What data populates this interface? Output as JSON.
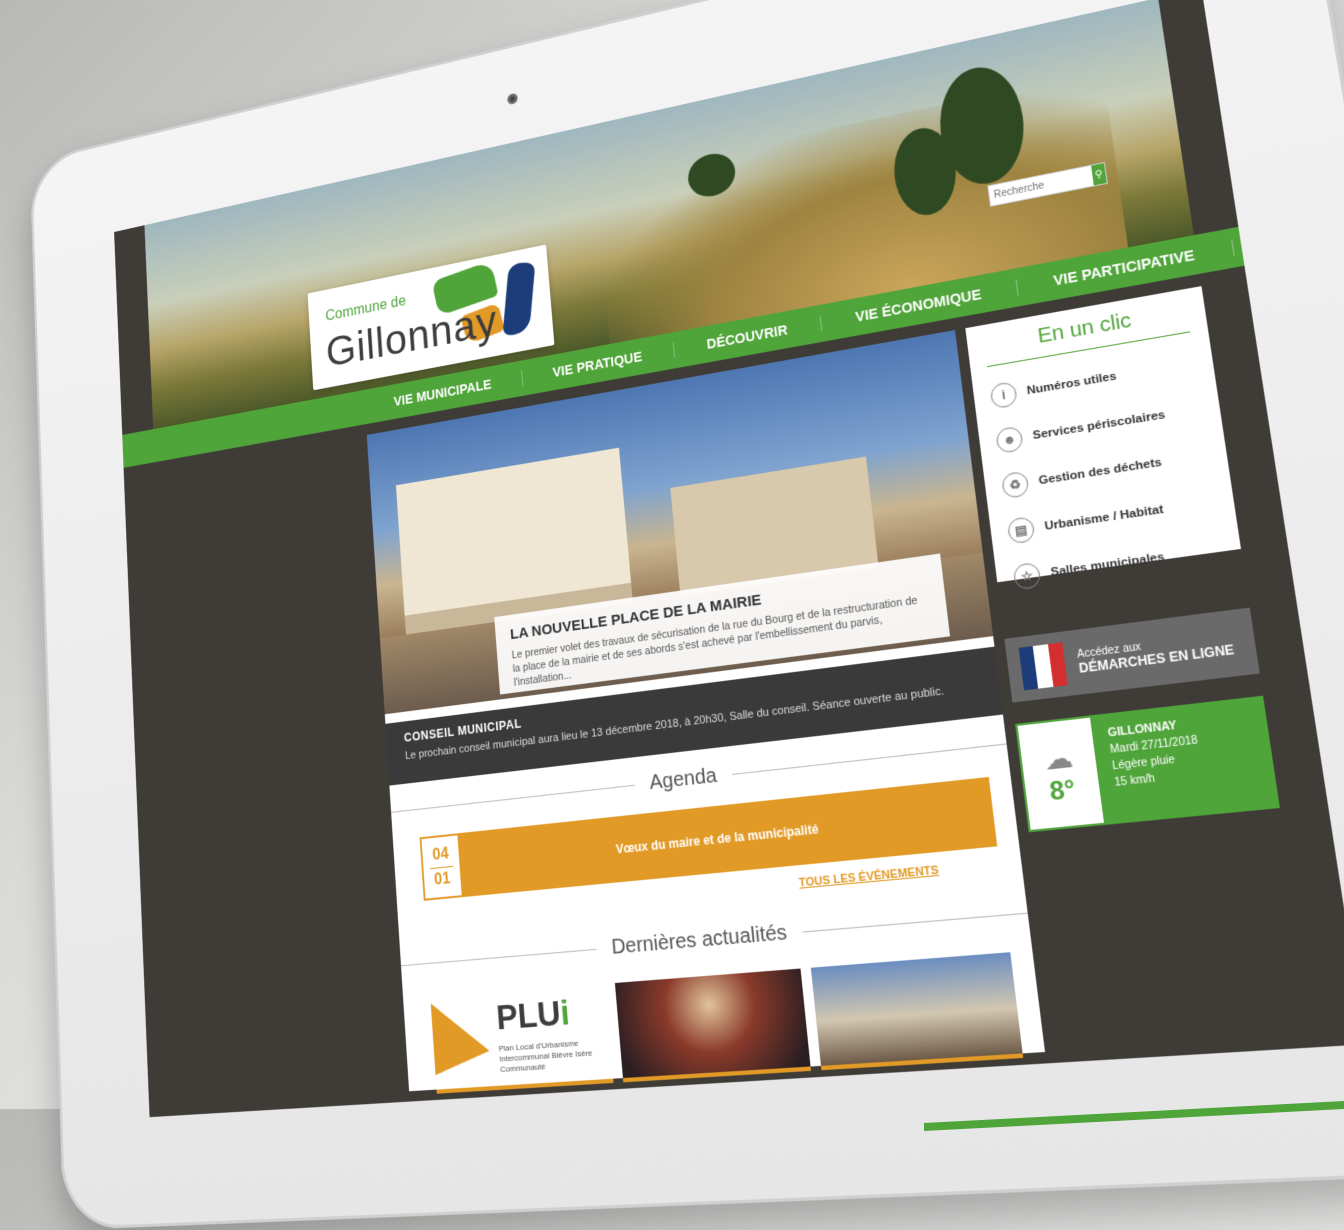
{
  "header": {
    "logo_small": "Commune de",
    "logo_big": "Gillonnay",
    "search_placeholder": "Recherche"
  },
  "nav": [
    "VIE MUNICIPALE",
    "VIE PRATIQUE",
    "DÉCOUVRIR",
    "VIE ÉCONOMIQUE",
    "VIE PARTICIPATIVE"
  ],
  "slide": {
    "title": "LA NOUVELLE PLACE DE LA MAIRIE",
    "desc": "Le premier volet des travaux de sécurisation de la rue du Bourg et de la restructuration de la place de la mairie et de ses abords s'est achevé par l'embellissement du parvis, l'installation..."
  },
  "conseil": {
    "title": "CONSEIL MUNICIPAL",
    "text": "Le prochain conseil municipal aura lieu le 13 décembre 2018, à 20h30, Salle du conseil. Séance ouverte au public."
  },
  "agenda": {
    "title": "Agenda",
    "event": {
      "day": "04",
      "month": "01",
      "label": "Vœux du maire et de la municipalité"
    },
    "all_events": "TOUS LES ÉVÉNEMENTS"
  },
  "news": {
    "title": "Dernières actualités",
    "plui_title": "PLU",
    "plui_i": "i",
    "plui_sub": "Plan Local d'Urbanisme Intercommunal Bièvre Isère Communauté"
  },
  "enclic": {
    "title": "En un clic",
    "items": [
      {
        "label": "Numéros utiles",
        "icon": "info-icon"
      },
      {
        "label": "Services périscolaires",
        "icon": "people-icon"
      },
      {
        "label": "Gestion des déchets",
        "icon": "trash-icon"
      },
      {
        "label": "Urbanisme / Habitat",
        "icon": "document-icon"
      },
      {
        "label": "Salles municipales",
        "icon": "star-icon"
      }
    ]
  },
  "demarches": {
    "line1": "Accédez aux",
    "line2": "DÉMARCHES EN LIGNE"
  },
  "meteo": {
    "city": "GILLONNAY",
    "date": "Mardi 27/11/2018",
    "condition": "Légère pluie",
    "wind": "15 km/h",
    "temp": "8°"
  },
  "colors": {
    "green": "#4fa43a",
    "orange": "#e29a27",
    "dark": "#3f3c38",
    "navy": "#1d3c7a"
  }
}
